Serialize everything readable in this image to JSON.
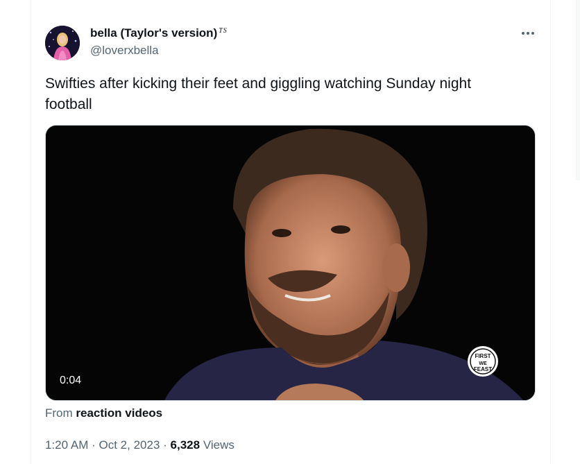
{
  "author": {
    "display_name": "bella (Taylor's version)",
    "badge": "TS",
    "handle": "@loverxbella"
  },
  "tweet": {
    "text": "Swifties after kicking their feet and giggling watching  Sunday night football"
  },
  "media": {
    "duration": "0:04",
    "watermark": "FIRST WE FEAST"
  },
  "source": {
    "prefix": "From",
    "name": "reaction videos"
  },
  "meta": {
    "time": "1:20 AM",
    "sep1": "·",
    "date": "Oct 2, 2023",
    "sep2": "·",
    "views_count": "6,328",
    "views_label": "Views"
  },
  "colors": {
    "text_primary": "#0f1419",
    "text_secondary": "#536471",
    "border": "#eff3f4"
  },
  "icons": [
    "more-options-icon"
  ]
}
